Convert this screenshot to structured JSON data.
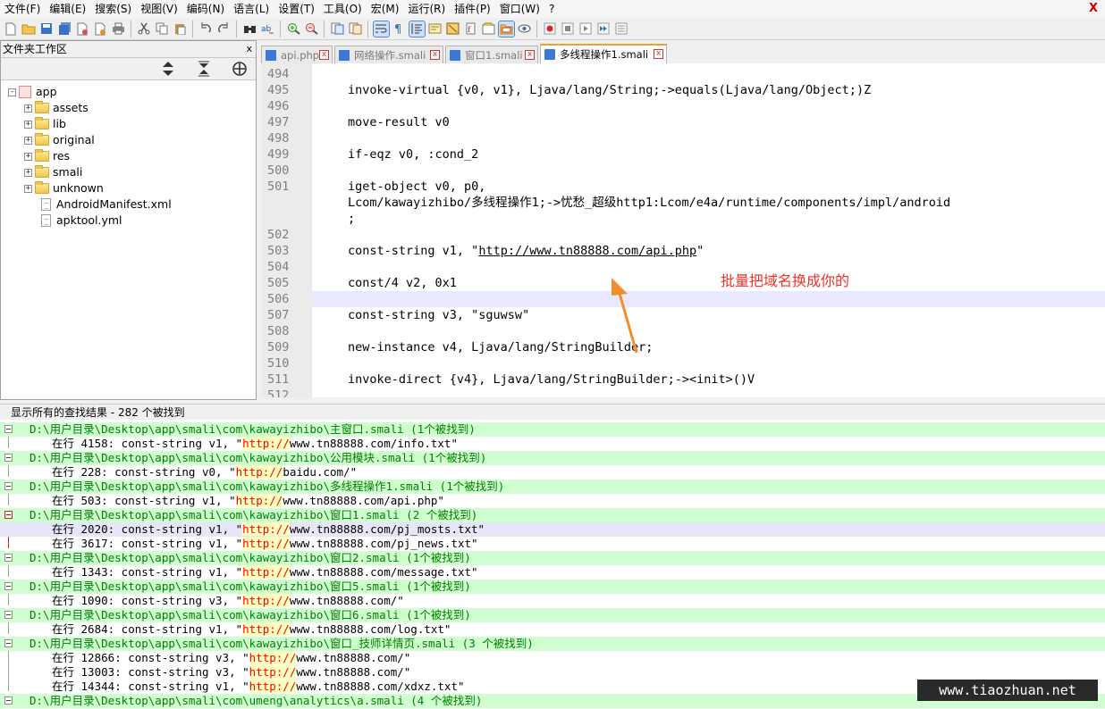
{
  "menu": [
    "文件(F)",
    "编辑(E)",
    "搜索(S)",
    "视图(V)",
    "编码(N)",
    "语言(L)",
    "设置(T)",
    "工具(O)",
    "宏(M)",
    "运行(R)",
    "插件(P)",
    "窗口(W)",
    "?"
  ],
  "menu_close": "X",
  "panel": {
    "title": "文件夹工作区",
    "close": "x",
    "tree": [
      {
        "label": "app",
        "kind": "root"
      },
      {
        "label": "assets",
        "kind": "folder"
      },
      {
        "label": "lib",
        "kind": "folder"
      },
      {
        "label": "original",
        "kind": "folder"
      },
      {
        "label": "res",
        "kind": "folder"
      },
      {
        "label": "smali",
        "kind": "folder"
      },
      {
        "label": "unknown",
        "kind": "folder"
      },
      {
        "label": "AndroidManifest.xml",
        "kind": "file"
      },
      {
        "label": "apktool.yml",
        "kind": "file"
      }
    ]
  },
  "tabs": [
    {
      "label": "api.php",
      "active": false
    },
    {
      "label": "网络操作.smali",
      "active": false
    },
    {
      "label": "窗口1.smali",
      "active": false
    },
    {
      "label": "多线程操作1.smali",
      "active": true
    }
  ],
  "editor": {
    "lines": [
      {
        "n": "494",
        "t": ""
      },
      {
        "n": "495",
        "t": "invoke-virtual {v0, v1}, Ljava/lang/String;->equals(Ljava/lang/Object;)Z"
      },
      {
        "n": "496",
        "t": ""
      },
      {
        "n": "497",
        "t": "move-result v0"
      },
      {
        "n": "498",
        "t": ""
      },
      {
        "n": "499",
        "t": "if-eqz v0, :cond_2"
      },
      {
        "n": "500",
        "t": ""
      },
      {
        "n": "501",
        "t": "iget-object v0, p0,"
      },
      {
        "n": "",
        "t": "Lcom/kawayizhibo/多线程操作1;->忧愁_超级http1:Lcom/e4a/runtime/components/impl/android"
      },
      {
        "n": "",
        "t": ";"
      },
      {
        "n": "502",
        "t": ""
      },
      {
        "n": "503",
        "t": "const-string v1, \"http://www.tn88888.com/api.php\""
      },
      {
        "n": "504",
        "t": ""
      },
      {
        "n": "505",
        "t": "const/4 v2, 0x1"
      },
      {
        "n": "506",
        "t": ""
      },
      {
        "n": "507",
        "t": "const-string v3, \"sguwsw\""
      },
      {
        "n": "508",
        "t": ""
      },
      {
        "n": "509",
        "t": "new-instance v4, Ljava/lang/StringBuilder;"
      },
      {
        "n": "510",
        "t": ""
      },
      {
        "n": "511",
        "t": "invoke-direct {v4}, Ljava/lang/StringBuilder;-><init>()V"
      },
      {
        "n": "512",
        "t": ""
      }
    ],
    "line503": {
      "pre": "const-string v1, \"",
      "url": "http://www.tn88888.com/api.php",
      "post": "\""
    },
    "annotation": "批量把域名换成你的"
  },
  "results": {
    "title": "显示所有的查找结果 - 282 个被找到",
    "rows": [
      {
        "type": "file",
        "text": "D:\\用户目录\\Desktop\\app\\smali\\com\\kawayizhibo\\主窗口.smali (1个被找到)"
      },
      {
        "type": "line",
        "prefix": "在行  4158:     const-string v1, \"",
        "hit": "http://",
        "suffix": "www.tn88888.com/info.txt\""
      },
      {
        "type": "file",
        "text": "D:\\用户目录\\Desktop\\app\\smali\\com\\kawayizhibo\\公用模块.smali (1个被找到)"
      },
      {
        "type": "line",
        "prefix": "在行  228:     const-string v0, \"",
        "hit": "http://",
        "suffix": "baidu.com/\""
      },
      {
        "type": "file",
        "text": "D:\\用户目录\\Desktop\\app\\smali\\com\\kawayizhibo\\多线程操作1.smali (1个被找到)"
      },
      {
        "type": "line",
        "prefix": "在行  503:     const-string v1, \"",
        "hit": "http://",
        "suffix": "www.tn88888.com/api.php\""
      },
      {
        "type": "file",
        "text": "D:\\用户目录\\Desktop\\app\\smali\\com\\kawayizhibo\\窗口1.smali (2 个被找到)"
      },
      {
        "type": "line",
        "prefix": "在行  2020:     const-string v1, \"",
        "hit": "http://",
        "suffix": "www.tn88888.com/pj_mosts.txt\""
      },
      {
        "type": "line",
        "prefix": "在行  3617:     const-string v1, \"",
        "hit": "http://",
        "suffix": "www.tn88888.com/pj_news.txt\""
      },
      {
        "type": "file",
        "text": "D:\\用户目录\\Desktop\\app\\smali\\com\\kawayizhibo\\窗口2.smali (1个被找到)"
      },
      {
        "type": "line",
        "prefix": "在行  1343:     const-string v1, \"",
        "hit": "http://",
        "suffix": "www.tn88888.com/message.txt\""
      },
      {
        "type": "file",
        "text": "D:\\用户目录\\Desktop\\app\\smali\\com\\kawayizhibo\\窗口5.smali (1个被找到)"
      },
      {
        "type": "line",
        "prefix": "在行  1090:     const-string v3, \"",
        "hit": "http://",
        "suffix": "www.tn88888.com/\""
      },
      {
        "type": "file",
        "text": "D:\\用户目录\\Desktop\\app\\smali\\com\\kawayizhibo\\窗口6.smali (1个被找到)"
      },
      {
        "type": "line",
        "prefix": "在行  2684:     const-string v1, \"",
        "hit": "http://",
        "suffix": "www.tn88888.com/log.txt\""
      },
      {
        "type": "file",
        "text": "D:\\用户目录\\Desktop\\app\\smali\\com\\kawayizhibo\\窗口_技师详情页.smali (3 个被找到)"
      },
      {
        "type": "line",
        "prefix": "在行  12866:     const-string v3, \"",
        "hit": "http://",
        "suffix": "www.tn88888.com/\""
      },
      {
        "type": "line",
        "prefix": "在行  13003:     const-string v3, \"",
        "hit": "http://",
        "suffix": "www.tn88888.com/\""
      },
      {
        "type": "line",
        "prefix": "在行  14344:     const-string v1, \"",
        "hit": "http://",
        "suffix": "www.tn88888.com/xdxz.txt\""
      },
      {
        "type": "file",
        "text": "D:\\用户目录\\Desktop\\app\\smali\\com\\umeng\\analytics\\a.smali (4 个被找到)"
      }
    ]
  },
  "watermark": "www.tiaozhuan.net"
}
